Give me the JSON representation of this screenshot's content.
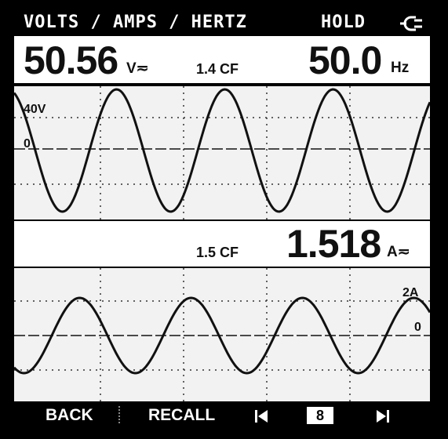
{
  "status": {
    "mode_title": "VOLTS / AMPS / HERTZ",
    "hold_label": "HOLD",
    "power_icon": "mains-plug-icon"
  },
  "voltage": {
    "value": "50.56",
    "unit": "V≂",
    "crest_factor": "1.4 CF"
  },
  "frequency": {
    "value": "50.0",
    "unit": "Hz"
  },
  "current": {
    "value": "1.518",
    "unit": "A≂",
    "crest_factor": "1.5 CF"
  },
  "voltage_trace": {
    "scale_label": "40V",
    "zero_label": "0"
  },
  "current_trace": {
    "scale_label": "2A",
    "zero_label": "0"
  },
  "softkeys": {
    "back": "BACK",
    "recall": "RECALL",
    "prev_icon": "skip-back-icon",
    "page_number": "8",
    "next_icon": "skip-forward-icon"
  },
  "colors": {
    "background": "#000000",
    "screen": "#f2f2f2",
    "trace": "#111111"
  }
}
